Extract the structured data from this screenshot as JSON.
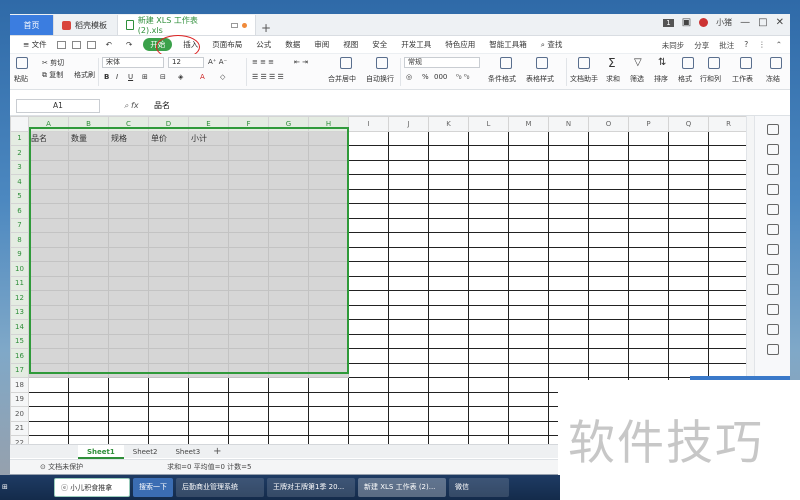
{
  "tabs": {
    "home": "首页",
    "templates": "稻壳模板",
    "active_doc": "新建 XLS 工作表 (2).xls"
  },
  "title_right": {
    "badge": "1",
    "user": "小猪"
  },
  "menu": {
    "file": "文件",
    "items": [
      "开始",
      "插入",
      "页面布局",
      "公式",
      "数据",
      "审阅",
      "视图",
      "安全",
      "开发工具",
      "特色应用",
      "智能工具箱"
    ],
    "search": "查找",
    "sync": "未同步",
    "share": "分享",
    "annotate": "批注",
    "help": "?"
  },
  "ribbon": {
    "paste": "粘贴",
    "cut": "剪切",
    "copy": "复制",
    "format_painter": "格式刷",
    "font": "宋体",
    "font_size": "12",
    "merge": "合并居中",
    "wrap": "自动换行",
    "number_format": "常规",
    "percent": "%",
    "thousands": "000",
    "cond_format": "条件格式",
    "table_style": "表格样式",
    "doc_helper": "文档助手",
    "sum": "求和",
    "filter": "筛选",
    "sort": "排序",
    "format": "格式",
    "row_col": "行和列",
    "worksheet": "工作表",
    "add": "冻结"
  },
  "formula_bar": {
    "cell_ref": "A1",
    "fx": "fx",
    "value": "品名"
  },
  "columns": [
    "A",
    "B",
    "C",
    "D",
    "E",
    "F",
    "G",
    "H",
    "I",
    "J",
    "K",
    "L",
    "M",
    "N",
    "O",
    "P",
    "Q",
    "R"
  ],
  "rows": [
    "1",
    "2",
    "3",
    "4",
    "5",
    "6",
    "7",
    "8",
    "9",
    "10",
    "11",
    "12",
    "13",
    "14",
    "15",
    "16",
    "17",
    "18",
    "19",
    "20",
    "21",
    "22"
  ],
  "headers_row": [
    "品名",
    "数量",
    "规格",
    "单价",
    "小计"
  ],
  "sheets": [
    "Sheet1",
    "Sheet2",
    "Sheet3"
  ],
  "sheet_plus": "+",
  "status": {
    "protect": "文档未保护",
    "sums": "求和=0  平均值=0  计数=5"
  },
  "watermark": "软件技巧",
  "taskbar": {
    "start": "小儿积食推拿",
    "search": "",
    "search_btn": "搜索一下",
    "apps": [
      "后勤商业管理系统",
      "王牌对王牌第1季 20...",
      "新建 XLS 工作表 (2)...",
      "微信"
    ]
  }
}
